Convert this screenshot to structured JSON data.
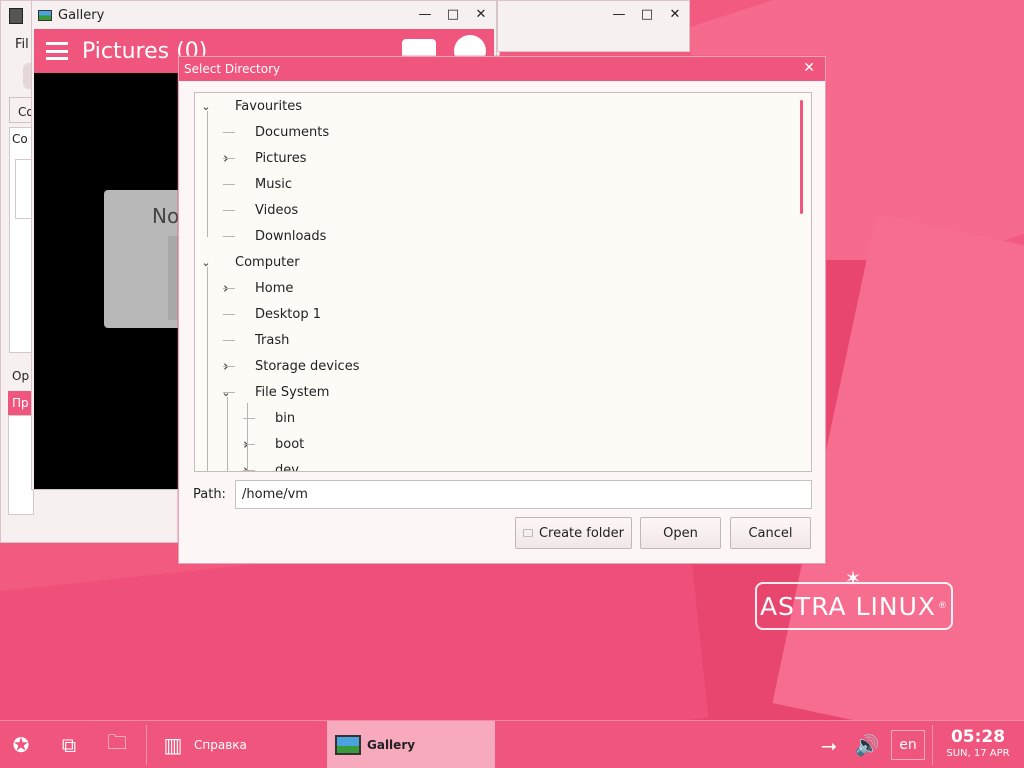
{
  "background_window": {
    "menu_label": "Fil",
    "side_tab1": "Co",
    "side_tab2": "Co",
    "side_label1": "Op",
    "side_label2": "Пр"
  },
  "gallery_window": {
    "title": "Gallery",
    "header_title": "Pictures (0)",
    "no_items_text": "No"
  },
  "dialog": {
    "title": "Select Directory",
    "tree": [
      {
        "label": "Favourites",
        "expander": "open"
      },
      {
        "label": "Documents",
        "expander": "none"
      },
      {
        "label": "Pictures",
        "expander": "closed"
      },
      {
        "label": "Music",
        "expander": "none"
      },
      {
        "label": "Videos",
        "expander": "none"
      },
      {
        "label": "Downloads",
        "expander": "none"
      },
      {
        "label": "Computer",
        "expander": "open"
      },
      {
        "label": "Home",
        "expander": "closed"
      },
      {
        "label": "Desktop 1",
        "expander": "none"
      },
      {
        "label": "Trash",
        "expander": "none"
      },
      {
        "label": "Storage devices",
        "expander": "closed"
      },
      {
        "label": "File System",
        "expander": "open"
      },
      {
        "label": "bin",
        "expander": "none"
      },
      {
        "label": "boot",
        "expander": "closed"
      },
      {
        "label": "dev",
        "expander": "closed"
      }
    ],
    "path_label": "Path:",
    "path_value": "/home/vm",
    "create_folder_label": "Create folder",
    "open_label": "Open",
    "cancel_label": "Cancel"
  },
  "desktop": {
    "logo_text": "ASTRA LINUX",
    "logo_reg": "®"
  },
  "taskbar": {
    "spravka_label": "Справка",
    "gallery_label": "Gallery",
    "language": "en",
    "time": "05:28",
    "date": "SUN, 17 APR"
  },
  "colors": {
    "accent": "#f0557e",
    "dialog_bg": "#fdf6f7"
  }
}
